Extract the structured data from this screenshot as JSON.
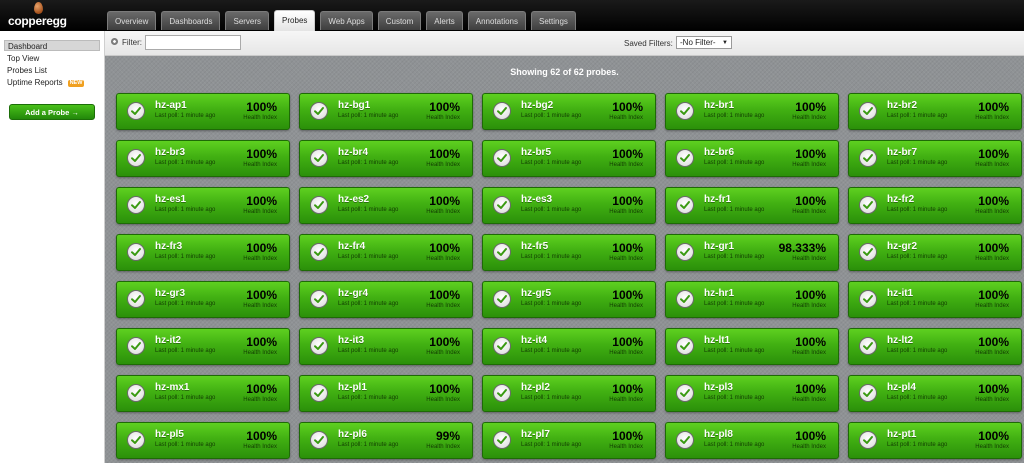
{
  "brand": {
    "name": "copperegg"
  },
  "tabs": [
    {
      "label": "Overview",
      "active": false
    },
    {
      "label": "Dashboards",
      "active": false
    },
    {
      "label": "Servers",
      "active": false
    },
    {
      "label": "Probes",
      "active": true
    },
    {
      "label": "Web Apps",
      "active": false
    },
    {
      "label": "Custom",
      "active": false
    },
    {
      "label": "Alerts",
      "active": false
    },
    {
      "label": "Annotations",
      "active": false
    },
    {
      "label": "Settings",
      "active": false
    }
  ],
  "sidebar": {
    "items": [
      {
        "label": "Dashboard",
        "active": true
      },
      {
        "label": "Top View",
        "active": false
      },
      {
        "label": "Probes List",
        "active": false
      },
      {
        "label": "Uptime Reports",
        "active": false,
        "badge": "NEW"
      }
    ],
    "add_button": "Add a Probe →"
  },
  "filter": {
    "label": "Filter:",
    "value": "",
    "placeholder": ""
  },
  "saved_filters": {
    "label": "Saved Filters:",
    "selected": "-No Filter-"
  },
  "summary": "Showing 62 of 62 probes.",
  "card_common": {
    "poll": "Last poll: 1 minute ago",
    "health_label": "Health Index"
  },
  "probes": [
    {
      "name": "hz-ap1",
      "health": "100%"
    },
    {
      "name": "hz-bg1",
      "health": "100%"
    },
    {
      "name": "hz-bg2",
      "health": "100%"
    },
    {
      "name": "hz-br1",
      "health": "100%"
    },
    {
      "name": "hz-br2",
      "health": "100%"
    },
    {
      "name": "hz-br3",
      "health": "100%"
    },
    {
      "name": "hz-br4",
      "health": "100%"
    },
    {
      "name": "hz-br5",
      "health": "100%"
    },
    {
      "name": "hz-br6",
      "health": "100%"
    },
    {
      "name": "hz-br7",
      "health": "100%"
    },
    {
      "name": "hz-es1",
      "health": "100%"
    },
    {
      "name": "hz-es2",
      "health": "100%"
    },
    {
      "name": "hz-es3",
      "health": "100%"
    },
    {
      "name": "hz-fr1",
      "health": "100%"
    },
    {
      "name": "hz-fr2",
      "health": "100%"
    },
    {
      "name": "hz-fr3",
      "health": "100%"
    },
    {
      "name": "hz-fr4",
      "health": "100%"
    },
    {
      "name": "hz-fr5",
      "health": "100%"
    },
    {
      "name": "hz-gr1",
      "health": "98.333%"
    },
    {
      "name": "hz-gr2",
      "health": "100%"
    },
    {
      "name": "hz-gr3",
      "health": "100%"
    },
    {
      "name": "hz-gr4",
      "health": "100%"
    },
    {
      "name": "hz-gr5",
      "health": "100%"
    },
    {
      "name": "hz-hr1",
      "health": "100%"
    },
    {
      "name": "hz-it1",
      "health": "100%"
    },
    {
      "name": "hz-it2",
      "health": "100%"
    },
    {
      "name": "hz-it3",
      "health": "100%"
    },
    {
      "name": "hz-it4",
      "health": "100%"
    },
    {
      "name": "hz-lt1",
      "health": "100%"
    },
    {
      "name": "hz-lt2",
      "health": "100%"
    },
    {
      "name": "hz-mx1",
      "health": "100%"
    },
    {
      "name": "hz-pl1",
      "health": "100%"
    },
    {
      "name": "hz-pl2",
      "health": "100%"
    },
    {
      "name": "hz-pl3",
      "health": "100%"
    },
    {
      "name": "hz-pl4",
      "health": "100%"
    },
    {
      "name": "hz-pl5",
      "health": "100%"
    },
    {
      "name": "hz-pl6",
      "health": "99%"
    },
    {
      "name": "hz-pl7",
      "health": "100%"
    },
    {
      "name": "hz-pl8",
      "health": "100%"
    },
    {
      "name": "hz-pt1",
      "health": "100%"
    }
  ]
}
